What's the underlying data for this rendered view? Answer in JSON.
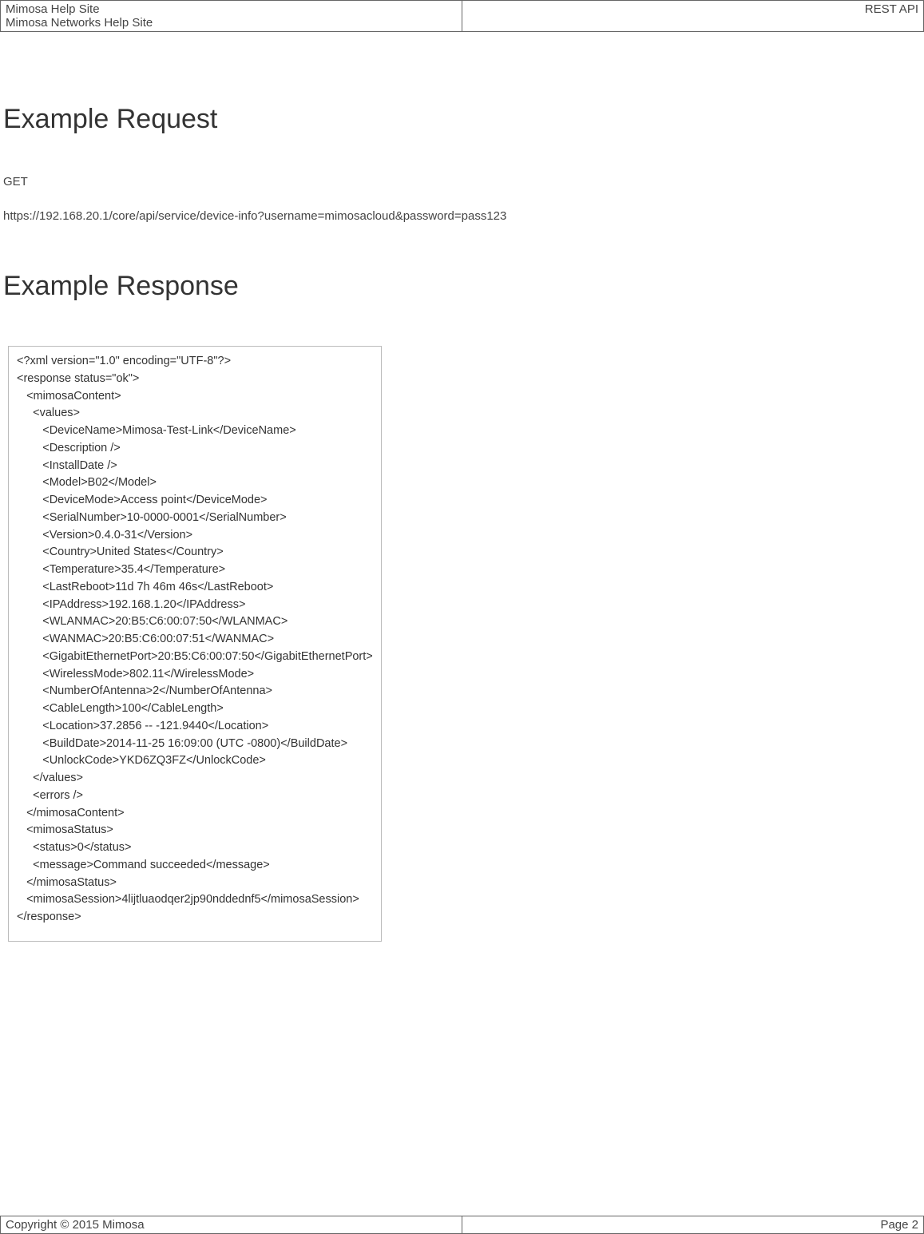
{
  "header": {
    "title_line1": "Mimosa Help Site",
    "title_line2": "Mimosa Networks Help Site",
    "right_label": "REST API"
  },
  "section_request": {
    "heading": "Example Request",
    "method": "GET",
    "url": "https://192.168.20.1/core/api/service/device-info?username=mimosacloud&password=pass123"
  },
  "section_response": {
    "heading": "Example Response",
    "xml_body": "<?xml version=\"1.0\" encoding=\"UTF-8\"?>\n<response status=\"ok\">\n   <mimosaContent>\n     <values>\n        <DeviceName>Mimosa-Test-Link</DeviceName>\n        <Description />\n        <InstallDate />\n        <Model>B02</Model>\n        <DeviceMode>Access point</DeviceMode>\n        <SerialNumber>10-0000-0001</SerialNumber>\n        <Version>0.4.0-31</Version>\n        <Country>United States</Country>\n        <Temperature>35.4</Temperature>\n        <LastReboot>11d 7h 46m 46s</LastReboot>\n        <IPAddress>192.168.1.20</IPAddress>\n        <WLANMAC>20:B5:C6:00:07:50</WLANMAC>\n        <WANMAC>20:B5:C6:00:07:51</WANMAC>\n        <GigabitEthernetPort>20:B5:C6:00:07:50</GigabitEthernetPort>\n        <WirelessMode>802.11</WirelessMode>\n        <NumberOfAntenna>2</NumberOfAntenna>\n        <CableLength>100</CableLength>\n        <Location>37.2856 -- -121.9440</Location>\n        <BuildDate>2014-11-25 16:09:00 (UTC -0800)</BuildDate>\n        <UnlockCode>YKD6ZQ3FZ</UnlockCode>\n     </values>\n     <errors />\n   </mimosaContent>\n   <mimosaStatus>\n     <status>0</status>\n     <message>Command succeeded</message>\n   </mimosaStatus>\n   <mimosaSession>4lijtluaodqer2jp90nddednf5</mimosaSession>\n</response>"
  },
  "footer": {
    "copyright": "Copyright © 2015 Mimosa",
    "page": "Page 2"
  }
}
